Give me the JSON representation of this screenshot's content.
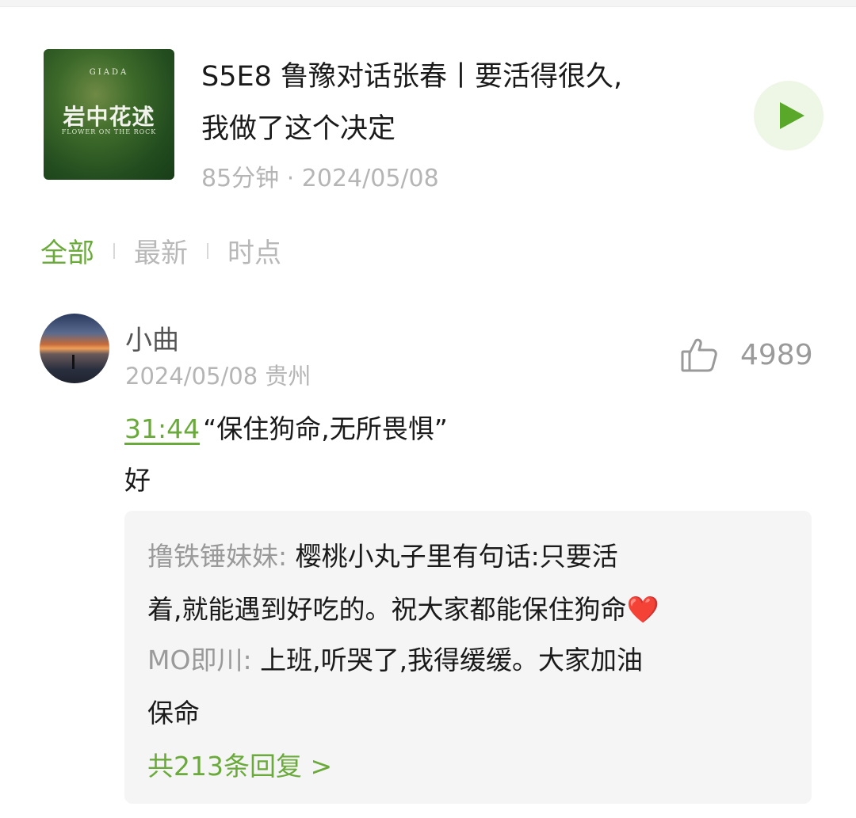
{
  "episode": {
    "cover": {
      "brand": "GIADA",
      "title": "岩中花述",
      "subtitle": "FLOWER ON THE ROCK"
    },
    "title_line1": "S5E8 鲁豫对话张春丨要活得很久,",
    "title_line2": "我做了这个决定",
    "meta": "85分钟 · 2024/05/08",
    "play_icon": "play-triangle"
  },
  "tabs": [
    {
      "label": "全部",
      "active": true
    },
    {
      "label": "最新",
      "active": false
    },
    {
      "label": "时点",
      "active": false
    }
  ],
  "comment": {
    "username": "小曲",
    "meta": "2024/05/08 贵州",
    "likes": "4989",
    "like_icon": "thumbs-up",
    "timestamp": "31:44",
    "quote": "“保住狗命,无所畏惧”",
    "body": "好"
  },
  "replies": {
    "items": [
      {
        "name": "撸铁锤妹妹:",
        "text_line1": "樱桃小丸子里有句话:只要活",
        "text_line2": "着,就能遇到好吃的。祝大家都能保住狗命",
        "emoji": "❤️"
      },
      {
        "name": "MO即川:",
        "text_line1": "上班,听哭了,我得缓缓。大家加油",
        "text_line2": "保命"
      }
    ],
    "more_label": "共213条回复 >"
  },
  "colors": {
    "accent_green": "#6aaa3a",
    "muted_gray": "#b5b5b5",
    "reply_bg": "#f5f5f5"
  }
}
